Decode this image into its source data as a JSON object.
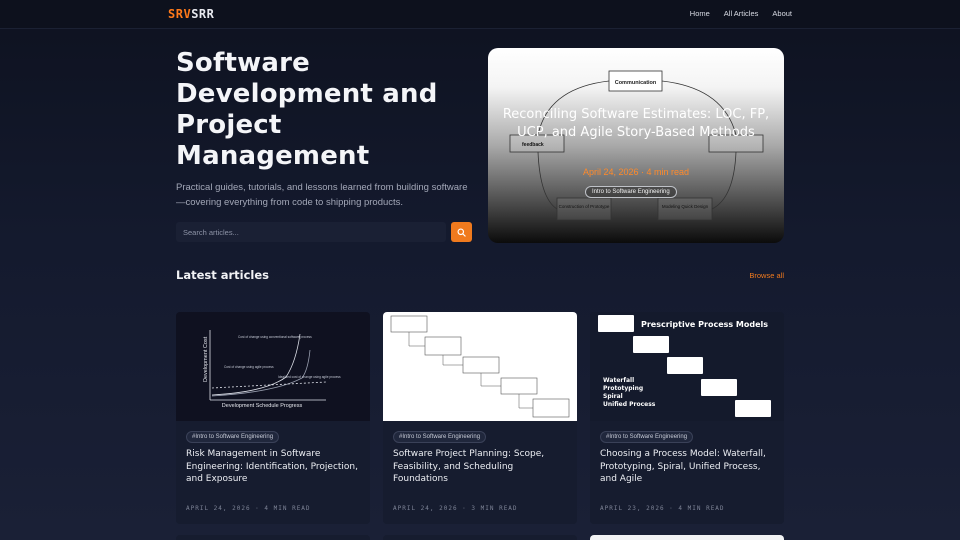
{
  "nav": {
    "logo_primary": "SRV",
    "logo_secondary": "SRR",
    "links": [
      "Home",
      "All Articles",
      "About"
    ]
  },
  "hero": {
    "title": "Software Development and Project Management",
    "subtitle": "Practical guides, tutorials, and lessons learned from building software—covering everything from code to shipping products.",
    "search_placeholder": "Search articles..."
  },
  "featured": {
    "title": "Reconciling Software Estimates: LOC, FP, UCP, and Agile Story-Based Methods",
    "meta": "April 24, 2026 · 4 min read",
    "tag": "Intro to Software Engineering",
    "diagram_labels": [
      "Communication",
      "feedback",
      "Construction of Prototype",
      "Modeling Quick Design"
    ]
  },
  "latest": {
    "heading": "Latest articles",
    "browse_label": "Browse all",
    "cards": [
      {
        "tag": "#Intro to Software Engineering",
        "title": "Risk Management in Software Engineering: Identification, Projection, and Exposure",
        "meta": "APRIL 24, 2026 · 4 MIN READ",
        "thumb": {
          "y_label": "Development Cost",
          "x_label": "Development Schedule Progress",
          "annotations": [
            "Cost of change using conventional software process",
            "Cost of change using agile process",
            "Idealized cost of change using agile process"
          ]
        }
      },
      {
        "tag": "#Intro to Software Engineering",
        "title": "Software Project Planning: Scope, Feasibility, and Scheduling Foundations",
        "meta": "APRIL 24, 2026 · 3 MIN READ"
      },
      {
        "tag": "#Intro to Software Engineering",
        "title": "Choosing a Process Model: Waterfall, Prototyping, Spiral, Unified Process, and Agile",
        "meta": "APRIL 23, 2026 · 4 MIN READ",
        "thumb": {
          "heading": "Prescriptive Process Models",
          "items": [
            "Waterfall",
            "Prototyping",
            "Spiral",
            "Unified Process"
          ]
        }
      }
    ]
  },
  "colors": {
    "accent": "#f07a1e",
    "background": "#141a2e",
    "card": "#161c2f"
  }
}
